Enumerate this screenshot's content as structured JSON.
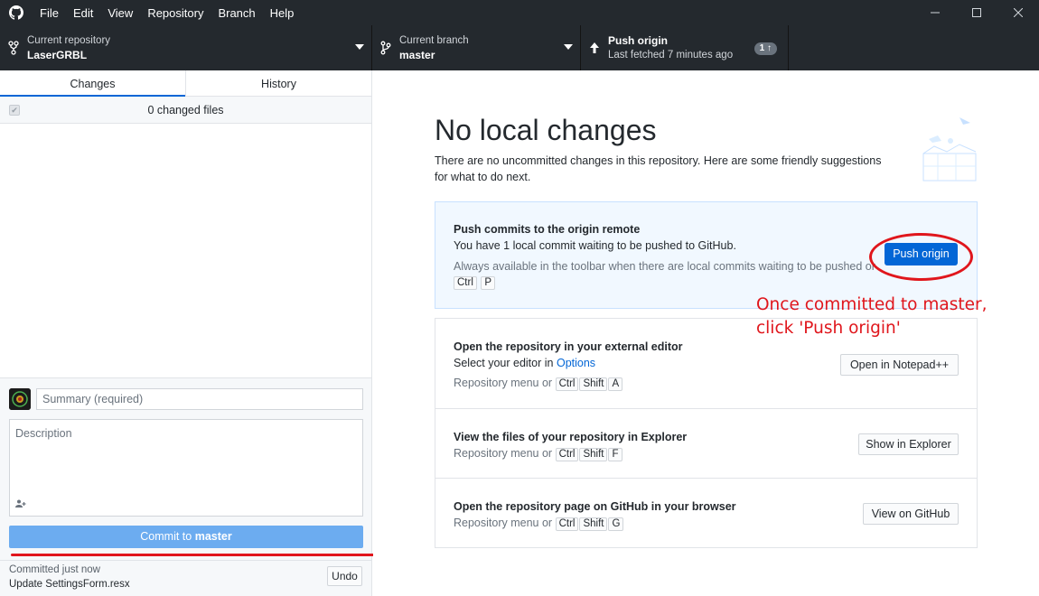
{
  "menu": [
    "File",
    "Edit",
    "View",
    "Repository",
    "Branch",
    "Help"
  ],
  "toolbar": {
    "repo_label": "Current repository",
    "repo_name": "LaserGRBL",
    "branch_label": "Current branch",
    "branch_name": "master",
    "push_title": "Push origin",
    "push_sub": "Last fetched 7 minutes ago",
    "push_badge": "1"
  },
  "sidebar": {
    "tabs": [
      "Changes",
      "History"
    ],
    "changed_files": "0 changed files",
    "summary_placeholder": "Summary (required)",
    "description_placeholder": "Description",
    "commit_prefix": "Commit to",
    "commit_branch": "master",
    "last_commit_when": "Committed just now",
    "last_commit_msg": "Update SettingsForm.resx",
    "undo_label": "Undo"
  },
  "main": {
    "heading": "No local changes",
    "subtext": "There are no uncommitted changes in this repository. Here are some friendly suggestions for what to do next.",
    "push_card": {
      "title": "Push commits to the origin remote",
      "line": "You have 1 local commit waiting to be pushed to GitHub.",
      "muted": "Always available in the toolbar when there are local commits waiting to be pushed or",
      "keys": [
        "Ctrl",
        "P"
      ],
      "button": "Push origin"
    },
    "editor_card": {
      "title": "Open the repository in your external editor",
      "line_prefix": "Select your editor in",
      "line_link": "Options",
      "menu_text": "Repository menu or",
      "keys": [
        "Ctrl",
        "Shift",
        "A"
      ],
      "button": "Open in Notepad++"
    },
    "explorer_card": {
      "title": "View the files of your repository in Explorer",
      "menu_text": "Repository menu or",
      "keys": [
        "Ctrl",
        "Shift",
        "F"
      ],
      "button": "Show in Explorer"
    },
    "github_card": {
      "title": "Open the repository page on GitHub in your browser",
      "menu_text": "Repository menu or",
      "keys": [
        "Ctrl",
        "Shift",
        "G"
      ],
      "button": "View on GitHub"
    },
    "annotation": "Once committed to master, click 'Push origin'"
  },
  "colors": {
    "accent": "#0366d6",
    "annotation_red": "#e0161c",
    "titlebar": "#24292e"
  }
}
